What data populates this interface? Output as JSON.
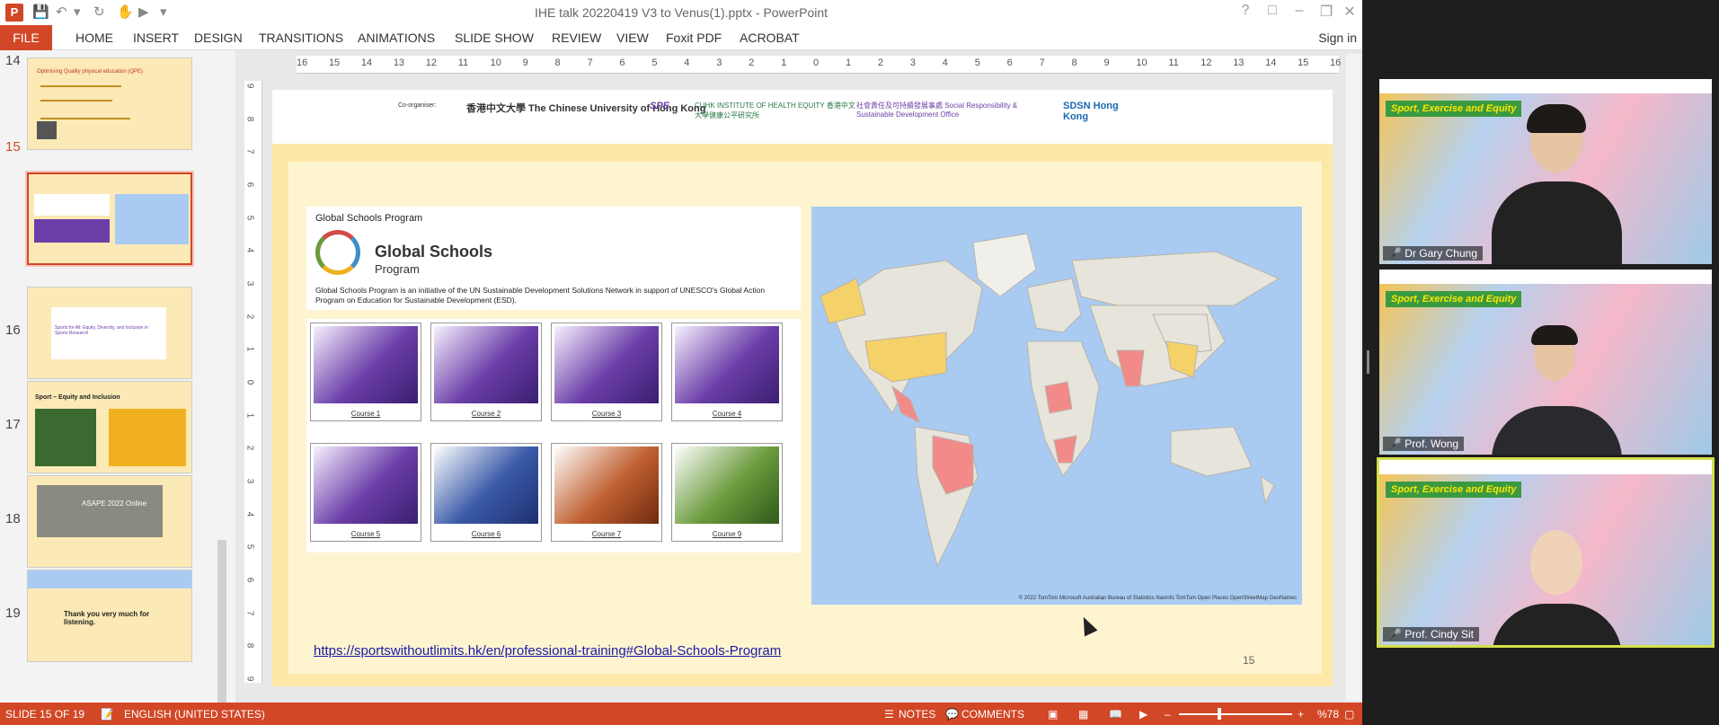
{
  "window": {
    "title": "IHE talk 20220419 V3 to Venus(1).pptx - PowerPoint",
    "help": "?",
    "minimize": "–",
    "restore": "❐",
    "close": "✕"
  },
  "ribbon": {
    "file": "FILE",
    "tabs": [
      "HOME",
      "INSERT",
      "DESIGN",
      "TRANSITIONS",
      "ANIMATIONS",
      "SLIDE SHOW",
      "REVIEW",
      "VIEW",
      "Foxit PDF",
      "ACROBAT"
    ],
    "signin": "Sign in"
  },
  "thumbnails": [
    {
      "num": "14",
      "text": "Optimising Quality physical education (QPE)"
    },
    {
      "num": "15",
      "text": "Global Schools Program"
    },
    {
      "num": "16",
      "text": "Sports for All: Equity, Diversity, and Inclusion in Sports Research"
    },
    {
      "num": "17",
      "text": "Sport – Equity and Inclusion"
    },
    {
      "num": "18",
      "text": "ASAPE 2022 Online"
    },
    {
      "num": "19",
      "text": "Thank you very much for listening."
    }
  ],
  "rulers": {
    "h": [
      "16",
      "15",
      "14",
      "13",
      "12",
      "11",
      "10",
      "9",
      "8",
      "7",
      "6",
      "5",
      "4",
      "3",
      "2",
      "1",
      "0",
      "1",
      "2",
      "3",
      "4",
      "5",
      "6",
      "7",
      "8",
      "9",
      "10",
      "11",
      "12",
      "13",
      "14",
      "15",
      "16"
    ],
    "v": [
      "9",
      "8",
      "7",
      "6",
      "5",
      "4",
      "3",
      "2",
      "1",
      "0",
      "1",
      "2",
      "3",
      "4",
      "5",
      "6",
      "7",
      "8",
      "9"
    ]
  },
  "slide": {
    "coorganiser": "Co-organiser:",
    "logos": [
      "香港中文大學 The Chinese University of Hong Kong",
      "SPE",
      "CUHK INSTITUTE OF HEALTH EQUITY 香港中文大學健康公平研究所",
      "社會責任及可持續發展事處 Social Responsibility & Sustainable Development Office",
      "SDSN Hong Kong"
    ],
    "gsp_label": "Global Schools Program",
    "gsp_title": "Global Schools",
    "gsp_sub": "Program",
    "gsp_desc": "Global Schools Program is an initiative of the UN Sustainable Development Solutions Network in support of UNESCO's Global Action Program on Education for Sustainable Development (ESD).",
    "courses": [
      "Course 1",
      "Course 2",
      "Course 3",
      "Course 4",
      "Course 5",
      "Course 6",
      "Course 7",
      "Course 9"
    ],
    "map_attribution": "© 2022 TomTom  Microsoft  Australian Bureau of Statistics  Navinfo  TomTom  Open Places  OpenStreetMap  GeoNames",
    "link": "https://sportswithoutlimits.hk/en/professional-training#Global-Schools-Program",
    "page_number": "15"
  },
  "status": {
    "slide": "SLIDE 15 OF 19",
    "language": "ENGLISH (UNITED STATES)",
    "notes": "NOTES",
    "comments": "COMMENTS",
    "zoom": "%78",
    "minus": "–",
    "plus": "+"
  },
  "participants": [
    {
      "name": "Dr Gary Chung",
      "banner": "Sport, Exercise and Equity"
    },
    {
      "name": "Prof. Wong",
      "banner": "Sport, Exercise and Equity"
    },
    {
      "name": "Prof. Cindy Sit",
      "banner": "Sport, Exercise and Equity"
    }
  ],
  "colors": {
    "accent": "#d24726",
    "active_speaker": "#d4e04a",
    "map_water": "#a9cbf2"
  }
}
